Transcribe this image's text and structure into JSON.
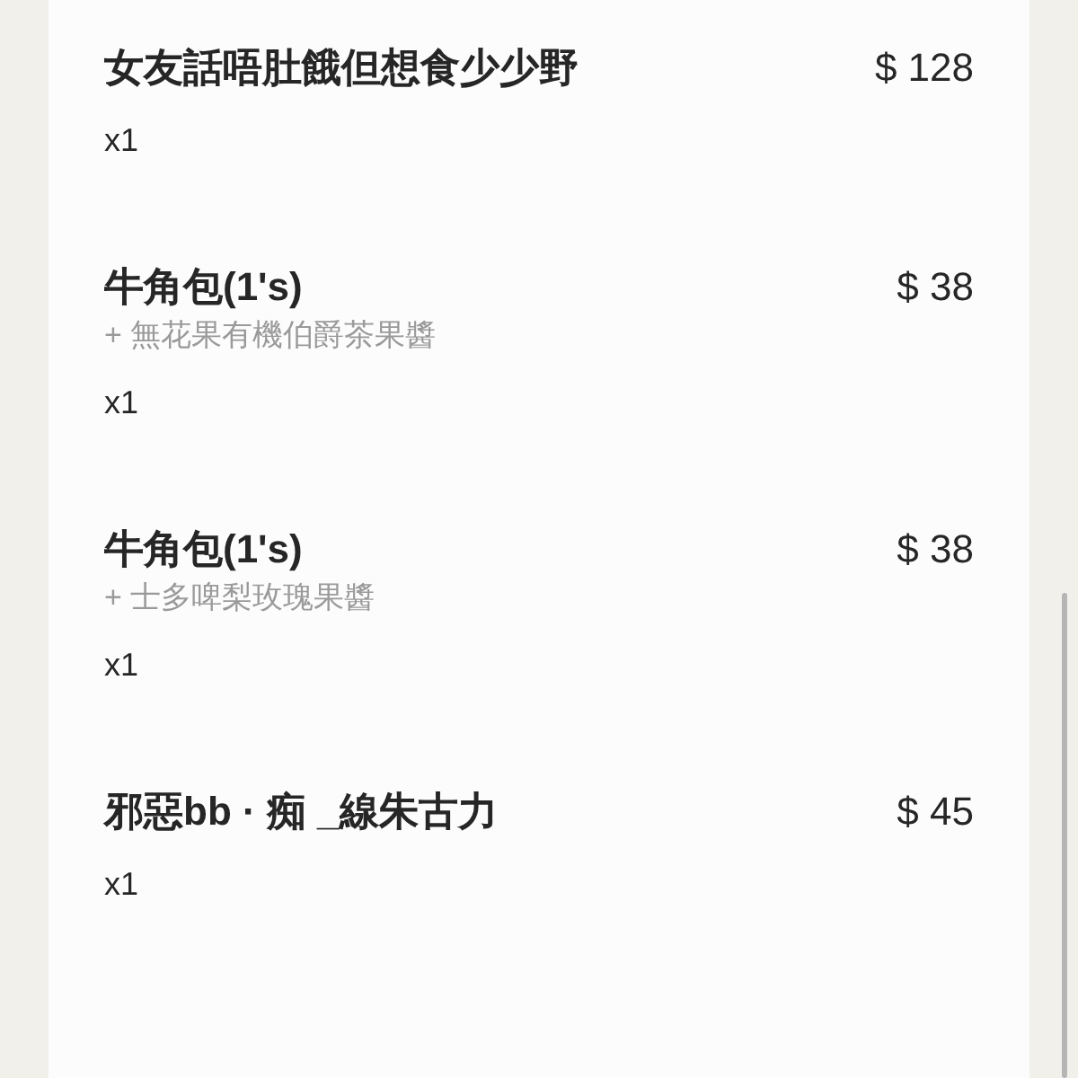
{
  "items": [
    {
      "name": "女友話唔肚餓但想食少少野",
      "price": "$ 128",
      "quantity": "x1"
    },
    {
      "name": "牛角包(1's)",
      "addon": "+ 無花果有機伯爵茶果醬",
      "price": "$ 38",
      "quantity": "x1"
    },
    {
      "name": "牛角包(1's)",
      "addon": "+ 士多啤梨玫瑰果醬",
      "price": "$ 38",
      "quantity": "x1"
    },
    {
      "name": "邪惡bb · 痴 _線朱古力",
      "price": "$ 45",
      "quantity": "x1"
    }
  ]
}
